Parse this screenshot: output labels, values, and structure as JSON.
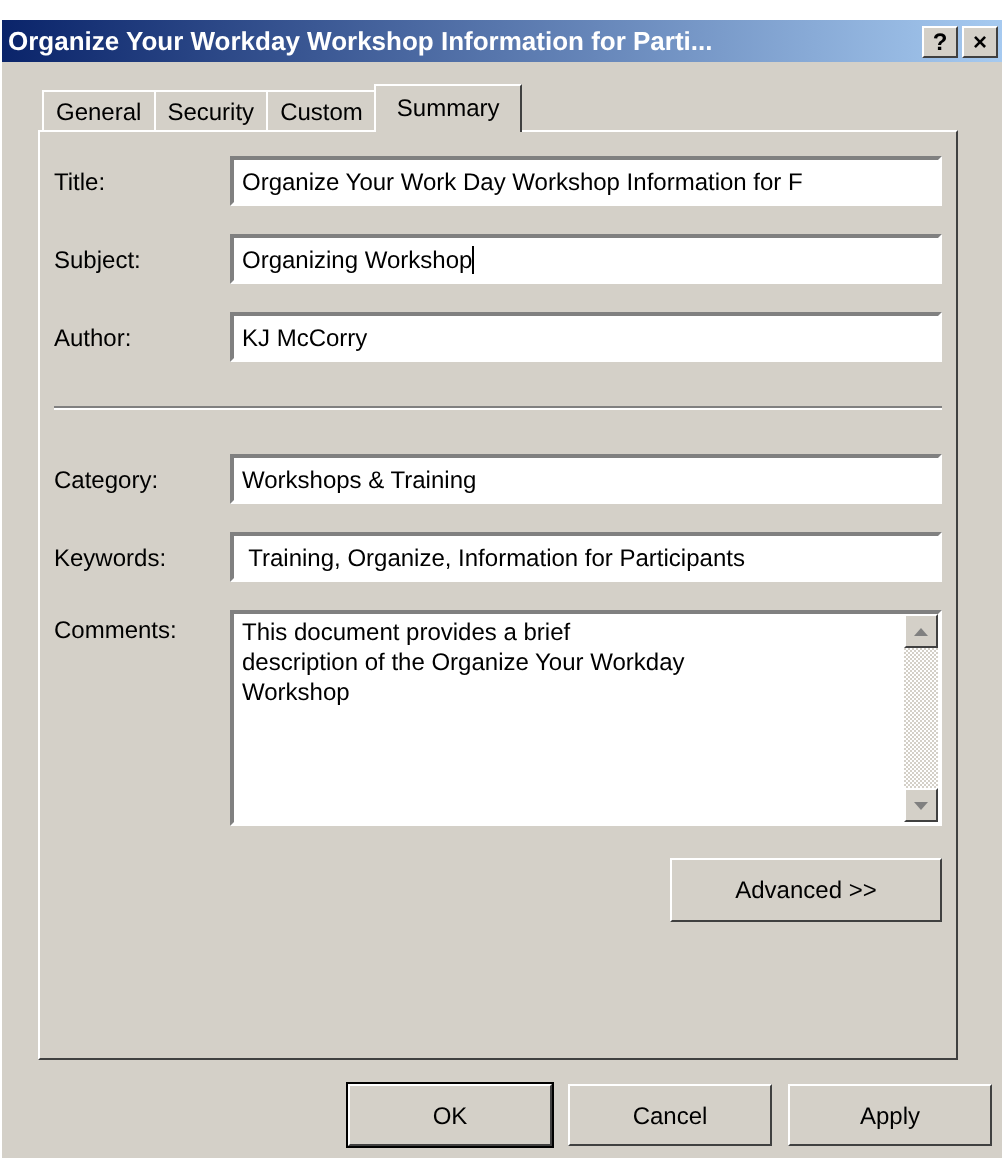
{
  "window": {
    "title": "Organize Your Workday Workshop Information for Parti...",
    "help_button": "?",
    "close_button": "×"
  },
  "tabs": [
    {
      "label": "General",
      "selected": false
    },
    {
      "label": "Security",
      "selected": false
    },
    {
      "label": "Custom",
      "selected": false
    },
    {
      "label": "Summary",
      "selected": true
    }
  ],
  "fields": [
    {
      "kind": "text",
      "label": "Title:",
      "value": "Organize Your Work Day Workshop Information for F",
      "focused": false
    },
    {
      "kind": "text",
      "label": "Subject:",
      "value": "Organizing Workshop",
      "focused": true
    },
    {
      "kind": "text",
      "label": "Author:",
      "value": "KJ McCorry",
      "focused": false
    },
    {
      "kind": "separator"
    },
    {
      "kind": "text",
      "label": "Category:",
      "value": "Workshops & Training",
      "focused": false
    },
    {
      "kind": "text",
      "label": "Keywords:",
      "value": " Training, Organize, Information for Participants",
      "focused": false
    },
    {
      "kind": "multiline",
      "label": "Comments:",
      "value": "This document provides a brief\ndescription of the Organize Your Workday\nWorkshop",
      "focused": false
    }
  ],
  "advanced_button": "Advanced >>",
  "buttons": [
    {
      "label": "OK",
      "default": true
    },
    {
      "label": "Cancel",
      "default": false
    },
    {
      "label": "Apply",
      "default": false
    }
  ]
}
